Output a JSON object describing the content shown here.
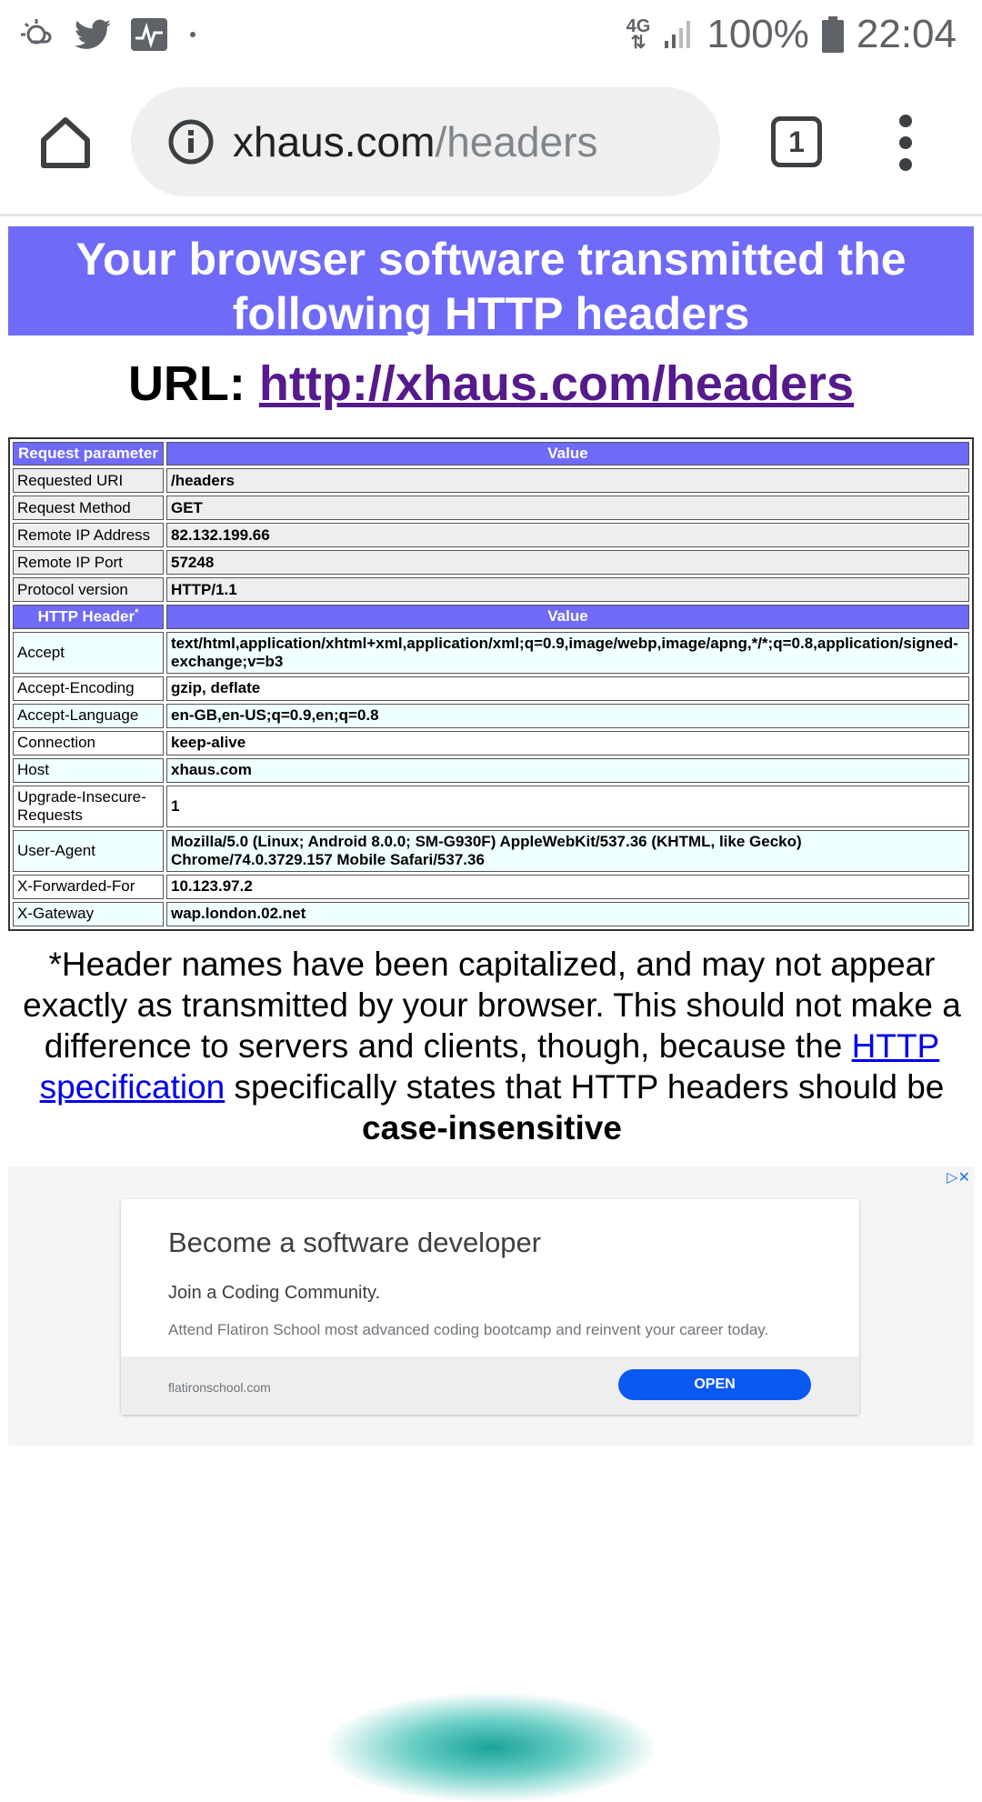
{
  "status_bar": {
    "network": "4G",
    "battery": "100%",
    "time": "22:04",
    "icons": [
      "weather-icon",
      "twitter-icon",
      "activity-icon",
      "dot-icon",
      "signal-icon",
      "battery-icon"
    ]
  },
  "browser": {
    "url_host": "xhaus.com",
    "url_path": "/headers",
    "tab_count": "1"
  },
  "page": {
    "banner": "Your browser software transmitted the following HTTP headers",
    "url_label": "URL: ",
    "url_link": "http://xhaus.com/headers",
    "request_table": {
      "header_key": "Request parameter",
      "header_value": "Value",
      "rows": [
        {
          "key": "Requested URI",
          "value": "/headers"
        },
        {
          "key": "Request Method",
          "value": "GET"
        },
        {
          "key": "Remote IP Address",
          "value": "82.132.199.66"
        },
        {
          "key": "Remote IP Port",
          "value": "57248"
        },
        {
          "key": "Protocol version",
          "value": "HTTP/1.1"
        }
      ]
    },
    "http_table": {
      "header_key": "HTTP Header",
      "header_key_mark": "*",
      "header_value": "Value",
      "rows": [
        {
          "key": "Accept",
          "value": "text/html,application/xhtml+xml,application/xml;q=0.9,image/webp,image/apng,*/*;q=0.8,application/signed-exchange;v=b3"
        },
        {
          "key": "Accept-Encoding",
          "value": "gzip, deflate"
        },
        {
          "key": "Accept-Language",
          "value": "en-GB,en-US;q=0.9,en;q=0.8"
        },
        {
          "key": "Connection",
          "value": "keep-alive"
        },
        {
          "key": "Host",
          "value": "xhaus.com"
        },
        {
          "key": "Upgrade-Insecure-Requests",
          "value": "1"
        },
        {
          "key": "User-Agent",
          "value": "Mozilla/5.0 (Linux; Android 8.0.0; SM-G930F) AppleWebKit/537.36 (KHTML, like Gecko) Chrome/74.0.3729.157 Mobile Safari/537.36"
        },
        {
          "key": "X-Forwarded-For",
          "value": "10.123.97.2"
        },
        {
          "key": "X-Gateway",
          "value": "wap.london.02.net"
        }
      ]
    },
    "note": {
      "part1": "*Header names have been capitalized, and may not appear exactly as transmitted by your browser. This should not make a difference to servers and clients, though, because the ",
      "link": "HTTP specification",
      "part2": " specifically states that HTTP headers should be ",
      "bold": "case-insensitive"
    }
  },
  "ad": {
    "choices": "▷✕",
    "title": "Become a software developer",
    "subtitle": "Join a Coding Community.",
    "description": "Attend Flatiron School most advanced coding bootcamp and reinvent your career today.",
    "domain": "flatironschool.com",
    "button": "OPEN"
  }
}
